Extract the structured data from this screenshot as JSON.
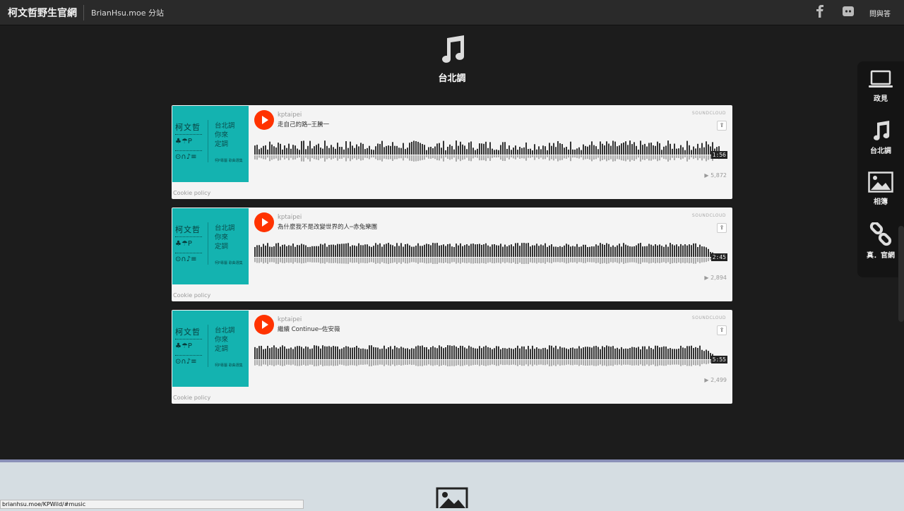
{
  "topbar": {
    "brand": "柯文哲野生官網",
    "sub_link": "BrianHsu.moe 分站",
    "qa_link": "問與答"
  },
  "section": {
    "title": "台北調",
    "icon": "music-note-icon"
  },
  "players": [
    {
      "uploader": "kptaipei",
      "title": "走自己的路─王騰一",
      "duration": "1:56",
      "plays": "5,872",
      "cookie": "Cookie policy",
      "wave_variant": "choppy"
    },
    {
      "uploader": "kptaipei",
      "title": "為什麼我不是改變世界的人─赤兔樂團",
      "duration": "2:45",
      "plays": "2,894",
      "cookie": "Cookie policy",
      "wave_variant": "dense"
    },
    {
      "uploader": "kptaipei",
      "title": "繼續 Continue─佐安薇",
      "duration": "5:55",
      "plays": "2,499",
      "cookie": "Cookie policy",
      "wave_variant": "dense"
    }
  ],
  "cover": {
    "name": "柯文哲",
    "sub1": "台北調",
    "sub2": "你來",
    "sub3": "定調",
    "small": "柯P專屬 歌曲選集",
    "symbols1": "♣☂P",
    "symbols2": "⊙∩♪≡"
  },
  "soundcloud_label": "SOUNDCLOUD",
  "sidenav": {
    "items": [
      {
        "label": "政見",
        "icon": "laptop-icon"
      },
      {
        "label": "台北調",
        "icon": "music-note-icon"
      },
      {
        "label": "相簿",
        "icon": "image-icon"
      },
      {
        "label": "真．官網",
        "icon": "link-icon"
      }
    ]
  },
  "status_url": "brianhsu.moe/KPWild/#music",
  "colors": {
    "soundcloud_orange": "#ff3300",
    "cover_teal": "#14b3b0",
    "background": "#1e1e1e"
  }
}
